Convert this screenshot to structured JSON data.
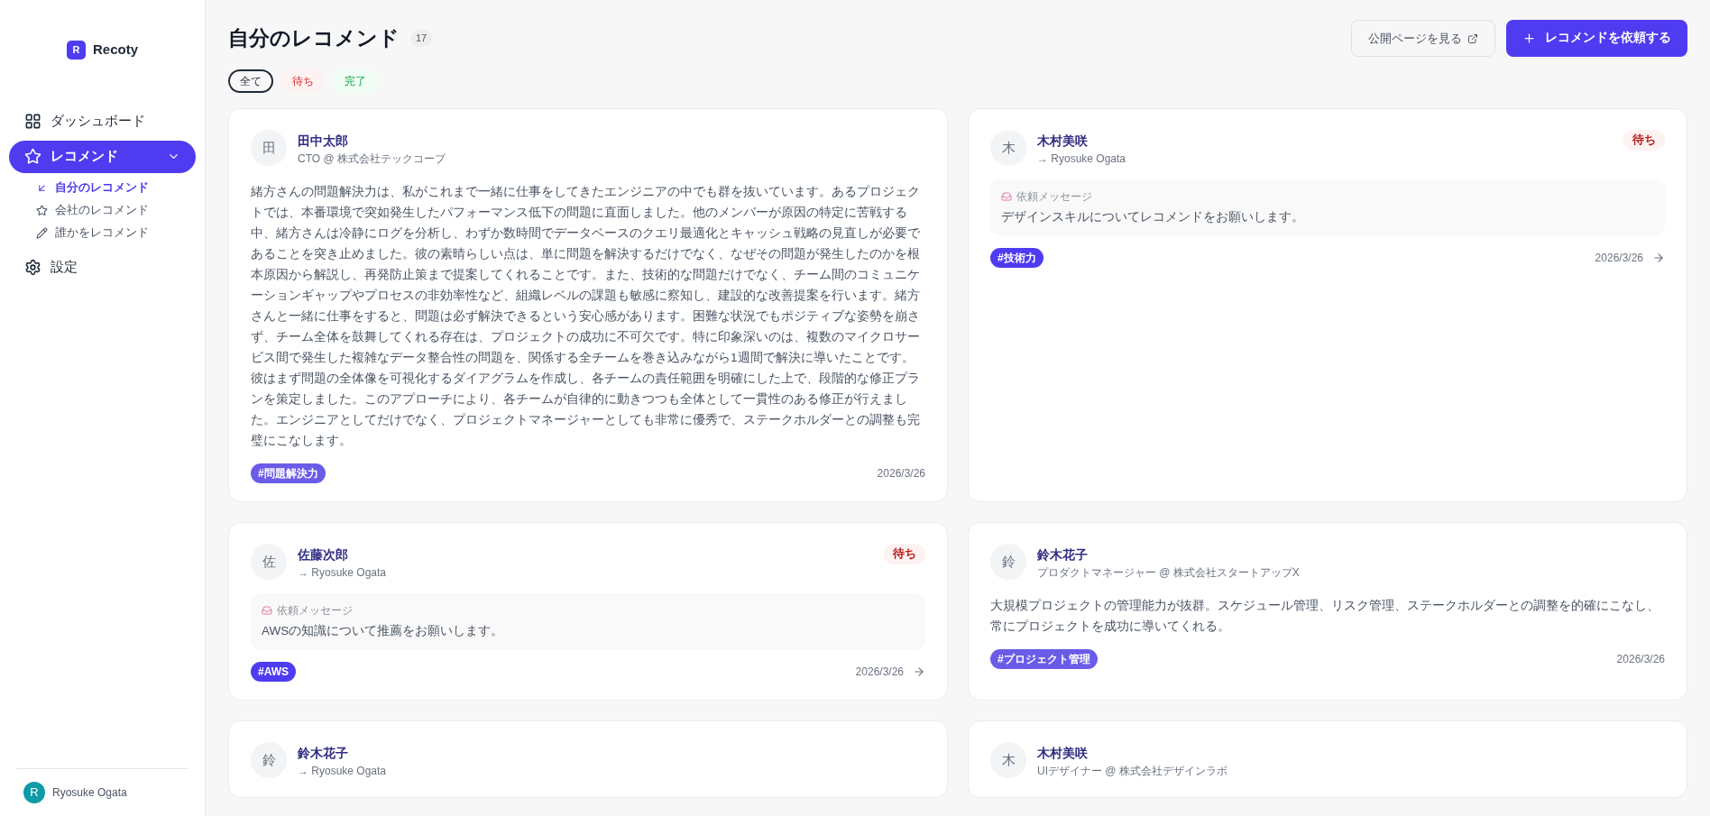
{
  "app": {
    "logo_letter": "R",
    "name": "Recoty"
  },
  "sidebar": {
    "items": [
      {
        "label": "ダッシュボード",
        "kind": "grid",
        "selected": false
      },
      {
        "label": "レコメンド",
        "kind": "star",
        "selected": true,
        "expanded": true,
        "children": [
          {
            "label": "自分のレコメンド",
            "kind": "arrow",
            "selected": true
          },
          {
            "label": "会社のレコメンド",
            "kind": "star",
            "selected": false
          },
          {
            "label": "誰かをレコメンド",
            "kind": "pencil",
            "selected": false
          }
        ]
      },
      {
        "label": "設定",
        "kind": "gear",
        "selected": false
      }
    ],
    "user": {
      "initial": "R",
      "name": "Ryosuke Ogata"
    }
  },
  "header": {
    "title": "自分のレコメンド",
    "count": "17",
    "public_button": "公開ページを見る",
    "request_button": "レコメンドを依頼する"
  },
  "filters": [
    {
      "label": "全て",
      "kind": "all",
      "selected": true
    },
    {
      "label": "待ち",
      "kind": "pending",
      "selected": false
    },
    {
      "label": "完了",
      "kind": "done",
      "selected": false
    }
  ],
  "cards": [
    {
      "kind": "recommendation",
      "avatar": "田",
      "name": "田中太郎",
      "subtitle": "CTO @ 株式会社テックコープ",
      "body": "緒方さんの問題解決力は、私がこれまで一緒に仕事をしてきたエンジニアの中でも群を抜いています。あるプロジェクトでは、本番環境で突如発生したパフォーマンス低下の問題に直面しました。他のメンバーが原因の特定に苦戦する中、緒方さんは冷静にログを分析し、わずか数時間でデータベースのクエリ最適化とキャッシュ戦略の見直しが必要であることを突き止めました。彼の素晴らしい点は、単に問題を解決するだけでなく、なぜその問題が発生したのかを根本原因から解説し、再発防止策まで提案してくれることです。また、技術的な問題だけでなく、チーム間のコミュニケーションギャップやプロセスの非効率性など、組織レベルの課題も敏感に察知し、建設的な改善提案を行います。緒方さんと一緒に仕事をすると、問題は必ず解決できるという安心感があります。困難な状況でもポジティブな姿勢を崩さず、チーム全体を鼓舞してくれる存在は、プロジェクトの成功に不可欠です。特に印象深いのは、複数のマイクロサービス間で発生した複雑なデータ整合性の問題を、関係する全チームを巻き込みながら1週間で解決に導いたことです。彼はまず問題の全体像を可視化するダイアグラムを作成し、各チームの責任範囲を明確にした上で、段階的な修正プランを策定しました。このアプローチにより、各チームが自律的に動きつつも全体として一貫性のある修正が行えました。エンジニアとしてだけでなく、プロジェクトマネージャーとしても非常に優秀で、ステークホルダーとの調整も完璧にこなします。",
      "tag": "#問題解決力",
      "date": "2026/3/26"
    },
    {
      "kind": "request",
      "avatar": "木",
      "name": "木村美咲",
      "subtitle": "→ Ryosuke Ogata",
      "status": "待ち",
      "message_label": "依頼メッセージ",
      "message": "デザインスキルについてレコメンドをお願いします。",
      "tag": "#技術力",
      "date": "2026/3/26"
    },
    {
      "kind": "request",
      "avatar": "佐",
      "name": "佐藤次郎",
      "subtitle": "→ Ryosuke Ogata",
      "status": "待ち",
      "message_label": "依頼メッセージ",
      "message": "AWSの知識について推薦をお願いします。",
      "tag": "#AWS",
      "date": "2026/3/26"
    },
    {
      "kind": "recommendation",
      "avatar": "鈴",
      "name": "鈴木花子",
      "subtitle": "プロダクトマネージャー @ 株式会社スタートアップX",
      "body": "大規模プロジェクトの管理能力が抜群。スケジュール管理、リスク管理、ステークホルダーとの調整を的確にこなし、常にプロジェクトを成功に導いてくれる。",
      "tag": "#プロジェクト管理",
      "date": "2026/3/26"
    },
    {
      "kind": "request",
      "avatar": "鈴",
      "name": "鈴木花子",
      "subtitle": "→ Ryosuke Ogata"
    },
    {
      "kind": "recommendation",
      "avatar": "木",
      "name": "木村美咲",
      "subtitle": "UIデザイナー @ 株式会社デザインラボ"
    }
  ]
}
